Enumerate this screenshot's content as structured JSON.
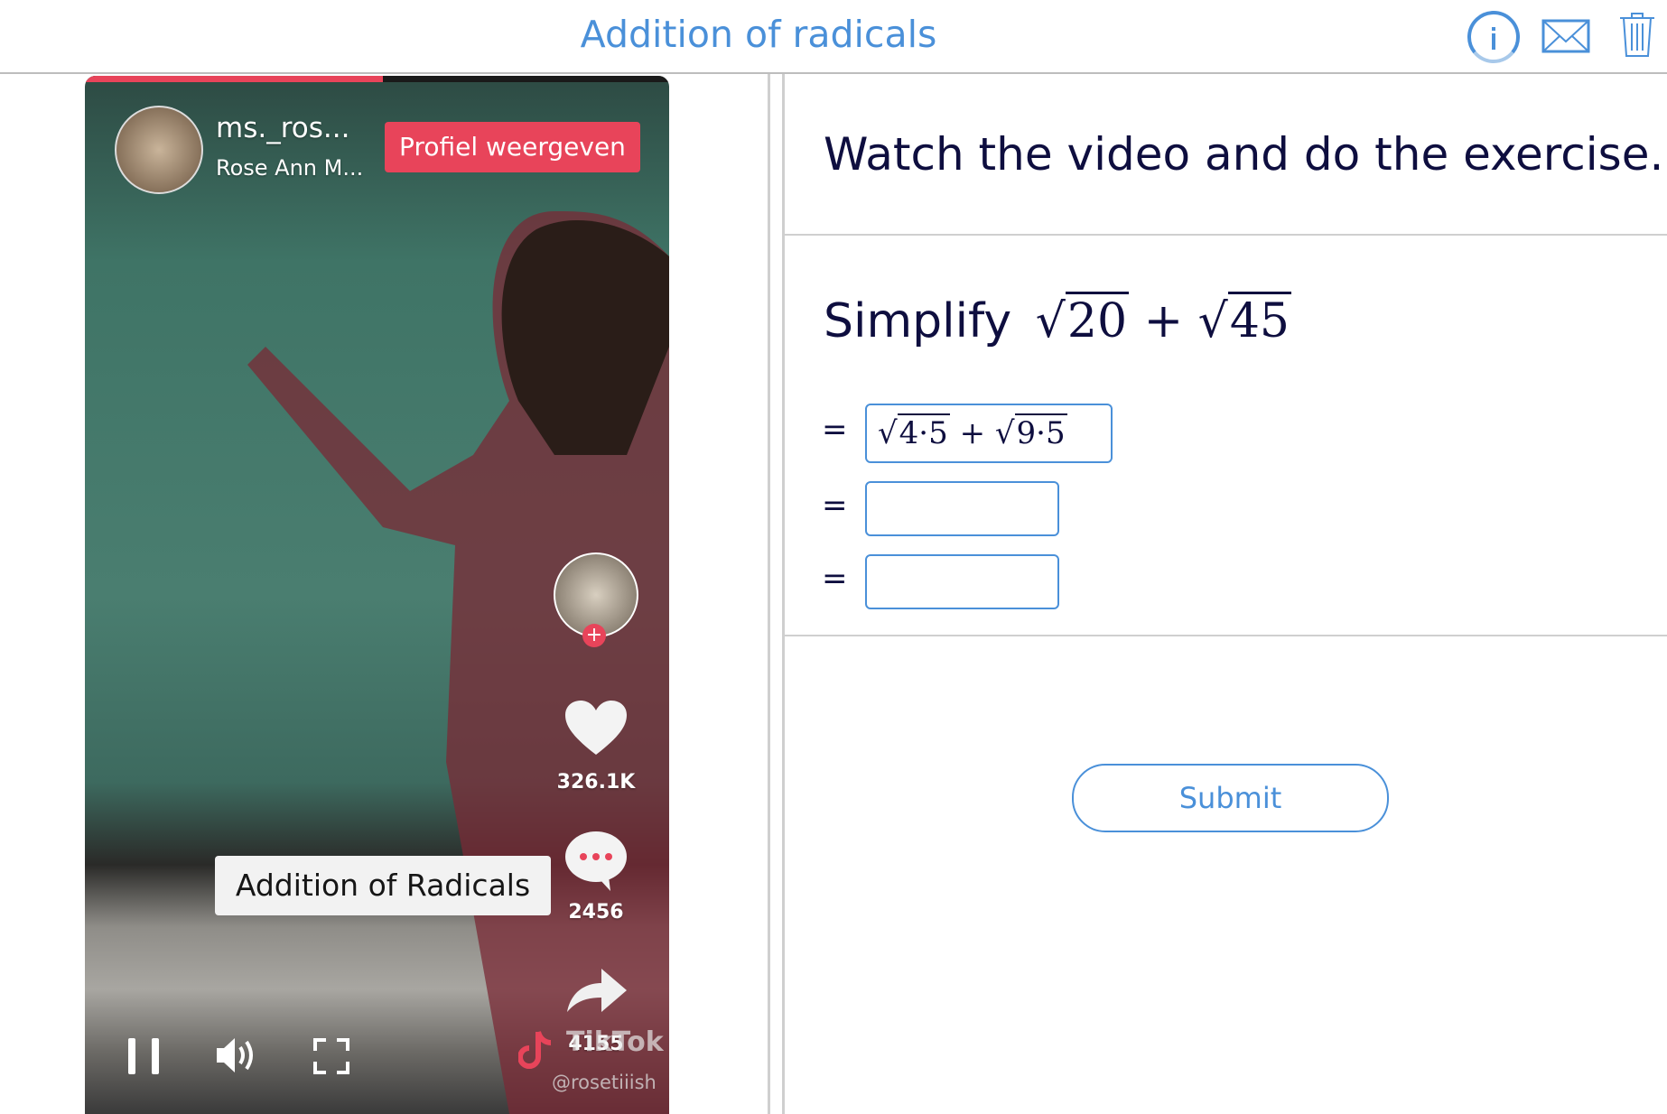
{
  "header": {
    "title": "Addition of radicals",
    "icons": [
      "info-icon",
      "mail-icon",
      "trash-icon"
    ],
    "accent": "#4a90d9"
  },
  "video": {
    "progress_percent": 51,
    "brand_color": "#e8445a",
    "username": "ms._ros...",
    "display_name": "Rose Ann M...",
    "profile_button": "Profiel weergeven",
    "likes": "326.1K",
    "comments": "2456",
    "shares": "4155",
    "caption": "Addition of Radicals",
    "watermark_handle": "@rosetiiish",
    "watermark_logo": "TikTok",
    "controls": [
      "pause-icon",
      "volume-icon",
      "fullscreen-icon"
    ]
  },
  "exercise": {
    "instruction": "Watch the video and do the exercise.",
    "prompt_word": "Simplify",
    "expr": {
      "r1": "20",
      "op": "+",
      "r2": "45"
    },
    "equals": "=",
    "step1": {
      "r1": "4·5",
      "op": "+",
      "r2": "9·5"
    },
    "step2_value": "",
    "step3_value": "",
    "submit_label": "Submit"
  }
}
